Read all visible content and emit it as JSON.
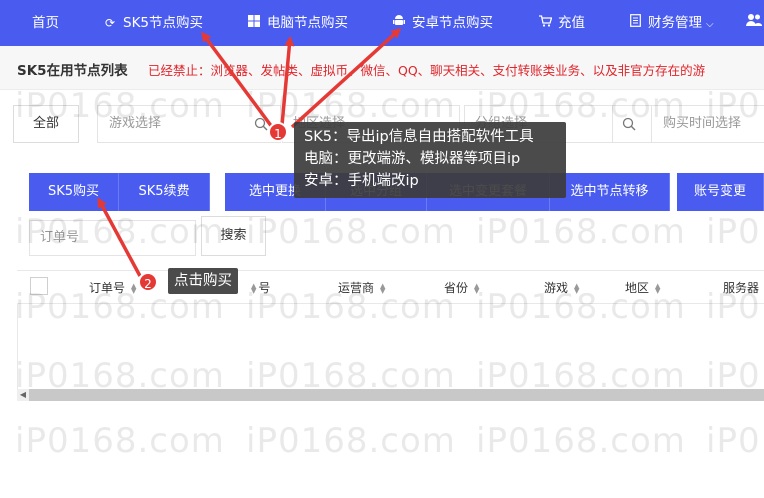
{
  "nav": {
    "home": "首页",
    "sk5": "SK5节点购买",
    "pc": "电脑节点购买",
    "android": "安卓节点购买",
    "recharge": "充值",
    "finance": "财务管理",
    "icons": {
      "sk5": "refresh-icon",
      "pc": "windows-icon",
      "android": "android-icon",
      "recharge": "cart-icon",
      "finance": "document-icon",
      "user": "user-icon"
    }
  },
  "notice": {
    "title": "SK5在用节点列表",
    "text": "已经禁止：浏览器、发帖类、虚拟币、微信、QQ、聊天相关、支付转账类业务、以及非官方存在的游"
  },
  "filters": {
    "all_label": "全部",
    "game_placeholder": "游戏选择",
    "region_placeholder": "地区选择",
    "group_placeholder": "分组选择",
    "time_placeholder": "购买时间选择"
  },
  "actions": {
    "buy": "SK5购买",
    "renew": "SK5续费",
    "change_selected": "选中更换",
    "group_selected": "选中分组",
    "change_plan": "选中变更套餐",
    "transfer": "选中节点转移",
    "account_change": "账号变更"
  },
  "search": {
    "order_placeholder": "订单号",
    "button": "搜索"
  },
  "table": {
    "headers": [
      "订单号",
      "运营商",
      "省份",
      "游戏",
      "地区",
      "服务器"
    ],
    "header_partial": "号"
  },
  "annotations": {
    "tip_lines": [
      "SK5：导出ip信息自由搭配软件工具",
      "电脑：更改端游、模拟器等项目ip",
      "安卓：手机端改ip"
    ],
    "tip_buy": "点击购买",
    "badge1": "1",
    "badge2": "2",
    "color": "#e53935"
  },
  "watermark": "iP0168.com",
  "colors": {
    "primary": "#4a5cf0",
    "danger": "#e0252b"
  }
}
